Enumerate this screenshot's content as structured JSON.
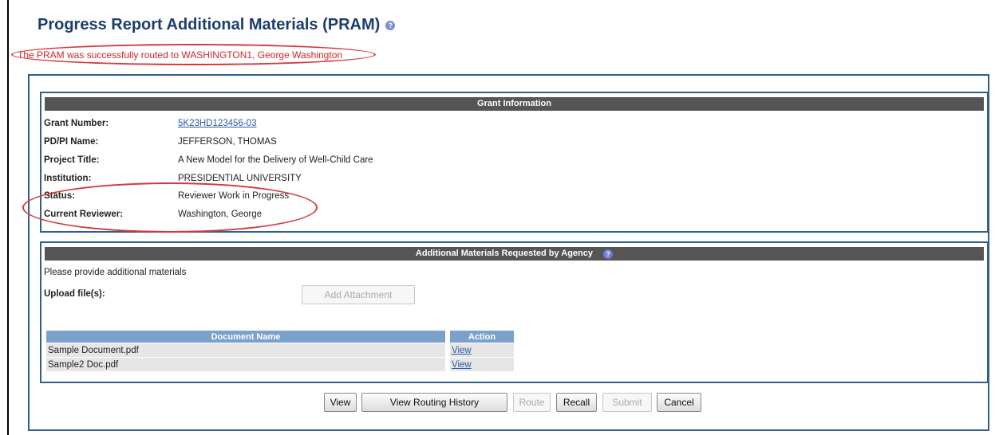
{
  "page": {
    "title": "Progress Report Additional Materials (PRAM)",
    "help_icon": "?",
    "message": "The PRAM was successfully routed to WASHINGTON1, George Washington"
  },
  "grant": {
    "header": "Grant Information",
    "rows": [
      {
        "label": "Grant Number:",
        "value": "5K23HD123456-03"
      },
      {
        "label": "PD/PI Name:",
        "value": "JEFFERSON, THOMAS"
      },
      {
        "label": "Project Title:",
        "value": "A New Model for the Delivery of Well-Child Care"
      },
      {
        "label": "Institution:",
        "value": "PRESIDENTIAL UNIVERSITY"
      },
      {
        "label": "Status:",
        "value": "Reviewer Work in Progress"
      },
      {
        "label": "Current Reviewer:",
        "value": "Washington, George"
      }
    ]
  },
  "materials": {
    "header": "Additional Materials Requested by Agency",
    "help_icon": "?",
    "instructions": "Please provide additional materials",
    "upload_label": "Upload file(s):",
    "add_attachment_label": "Add Attachment",
    "columns": {
      "name": "Document Name",
      "action": "Action"
    },
    "documents": [
      {
        "name": "Sample Document.pdf",
        "action": "View"
      },
      {
        "name": "Sample2 Doc.pdf",
        "action": "View"
      }
    ]
  },
  "actions": {
    "view": "View",
    "routing_history": "View Routing History",
    "route": "Route",
    "recall": "Recall",
    "submit": "Submit",
    "cancel": "Cancel"
  },
  "colors": {
    "title": "#1c3d6e",
    "message": "#d2232a",
    "annotation_oval": "#d23a3a",
    "panel_border": "#2f5f8c",
    "header_bar": "#555555",
    "table_header": "#7ba0cc",
    "link": "#2a5aa5"
  }
}
